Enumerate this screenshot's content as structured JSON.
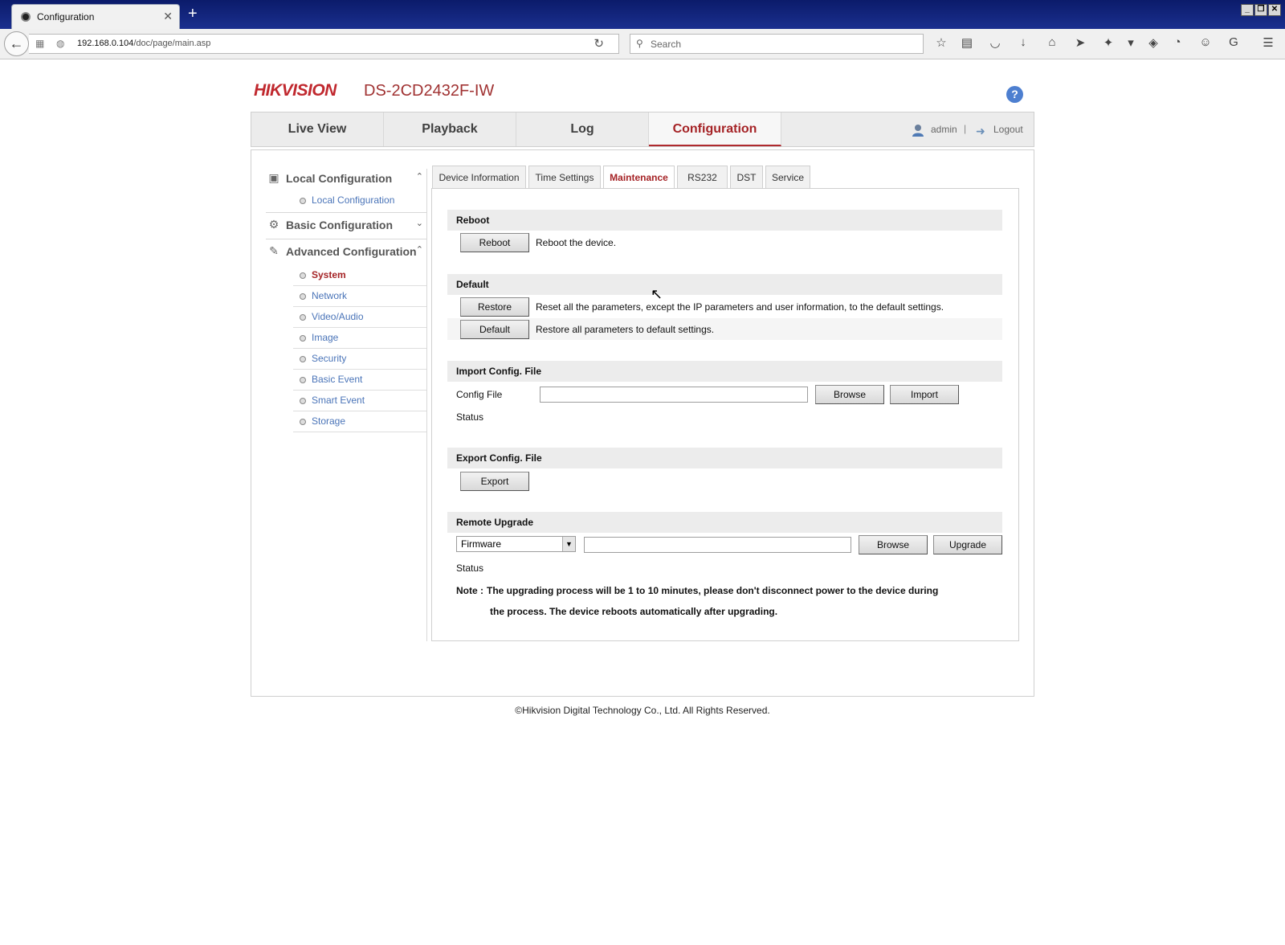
{
  "browser": {
    "tab_title": "Configuration",
    "url_host": "192.168.0.104",
    "url_path": "/doc/page/main.asp",
    "search_placeholder": "Search"
  },
  "header": {
    "logo": "HIKVISION",
    "model": "DS-2CD2432F-IW",
    "help": "?"
  },
  "main_nav": {
    "tabs": [
      "Live View",
      "Playback",
      "Log",
      "Configuration"
    ],
    "active": "Configuration",
    "user": "admin",
    "separator": "|",
    "logout": "Logout"
  },
  "sidebar": {
    "local_config": "Local Configuration",
    "local_config_item": "Local Configuration",
    "basic_config": "Basic Configuration",
    "advanced_config": "Advanced Configuration",
    "items": [
      "System",
      "Network",
      "Video/Audio",
      "Image",
      "Security",
      "Basic Event",
      "Smart Event",
      "Storage"
    ],
    "active": "System"
  },
  "subtabs": {
    "items": [
      "Device Information",
      "Time Settings",
      "Maintenance",
      "RS232",
      "DST",
      "Service"
    ],
    "active": "Maintenance"
  },
  "reboot": {
    "title": "Reboot",
    "button": "Reboot",
    "desc": "Reboot the device."
  },
  "default": {
    "title": "Default",
    "restore_button": "Restore",
    "restore_desc": "Reset all the parameters, except the IP parameters and user information, to the default settings.",
    "default_button": "Default",
    "default_desc": "Restore all parameters to default settings."
  },
  "import": {
    "title": "Import Config. File",
    "file_label": "Config File",
    "file_value": "",
    "browse": "Browse",
    "import": "Import",
    "status_label": "Status"
  },
  "export": {
    "title": "Export Config. File",
    "button": "Export"
  },
  "upgrade": {
    "title": "Remote Upgrade",
    "select_value": "Firmware",
    "file_value": "",
    "browse": "Browse",
    "upgrade": "Upgrade",
    "status_label": "Status",
    "note_label": "Note :",
    "note_line1": "The upgrading process will be 1 to 10 minutes, please don't disconnect power to the device during",
    "note_line2": "the process. The device reboots automatically after upgrading."
  },
  "footer": "©Hikvision Digital Technology Co., Ltd. All Rights Reserved."
}
